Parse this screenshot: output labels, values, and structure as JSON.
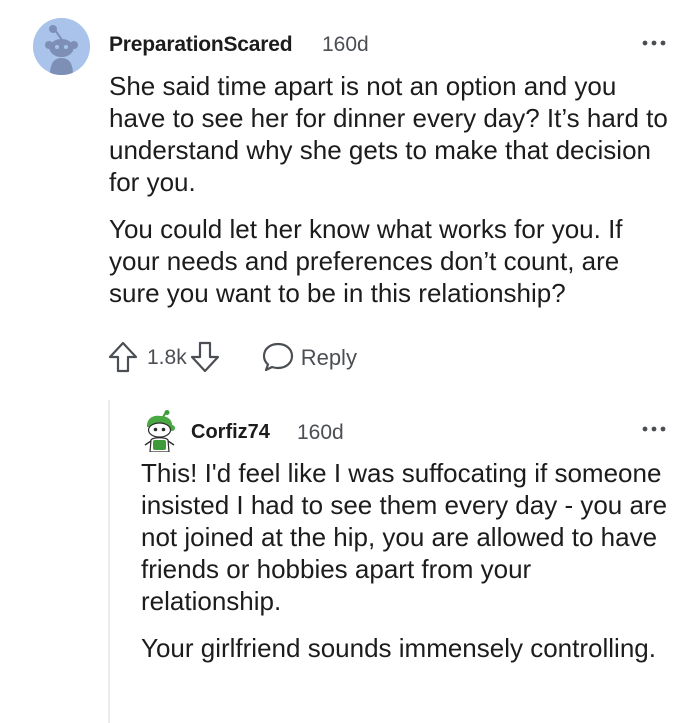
{
  "comment": {
    "author": "PreparationScared",
    "age": "160d",
    "paragraphs": [
      "She said time apart is not an option and you have to see her for dinner every day? It’s hard to understand why she gets to make that decision for you.",
      "You could let her know what works for you. If your needs and preferences don’t count, are sure you want to be in this relationship?"
    ],
    "votes": "1.8k",
    "reply_label": "Reply",
    "avatar_icon": "reddit-snoo-avatar",
    "avatar_color": "#a9c3ea"
  },
  "reply": {
    "author": "Corfiz74",
    "age": "160d",
    "paragraphs": [
      "This! I'd feel like I was suffocating if someone insisted I had to see them every day - you are not joined at the hip, you are allowed to have friends or hobbies apart from your relationship.",
      "Your girlfriend sounds immensely controlling."
    ],
    "avatar_icon": "green-snoo-avatar"
  },
  "icons": {
    "more": "more-options-icon",
    "upvote": "upvote-arrow-icon",
    "downvote": "downvote-arrow-icon",
    "reply": "speech-bubble-icon"
  },
  "colors": {
    "text": "#1c1c1c",
    "meta": "#4b4f53",
    "thread_line": "#ededed"
  }
}
